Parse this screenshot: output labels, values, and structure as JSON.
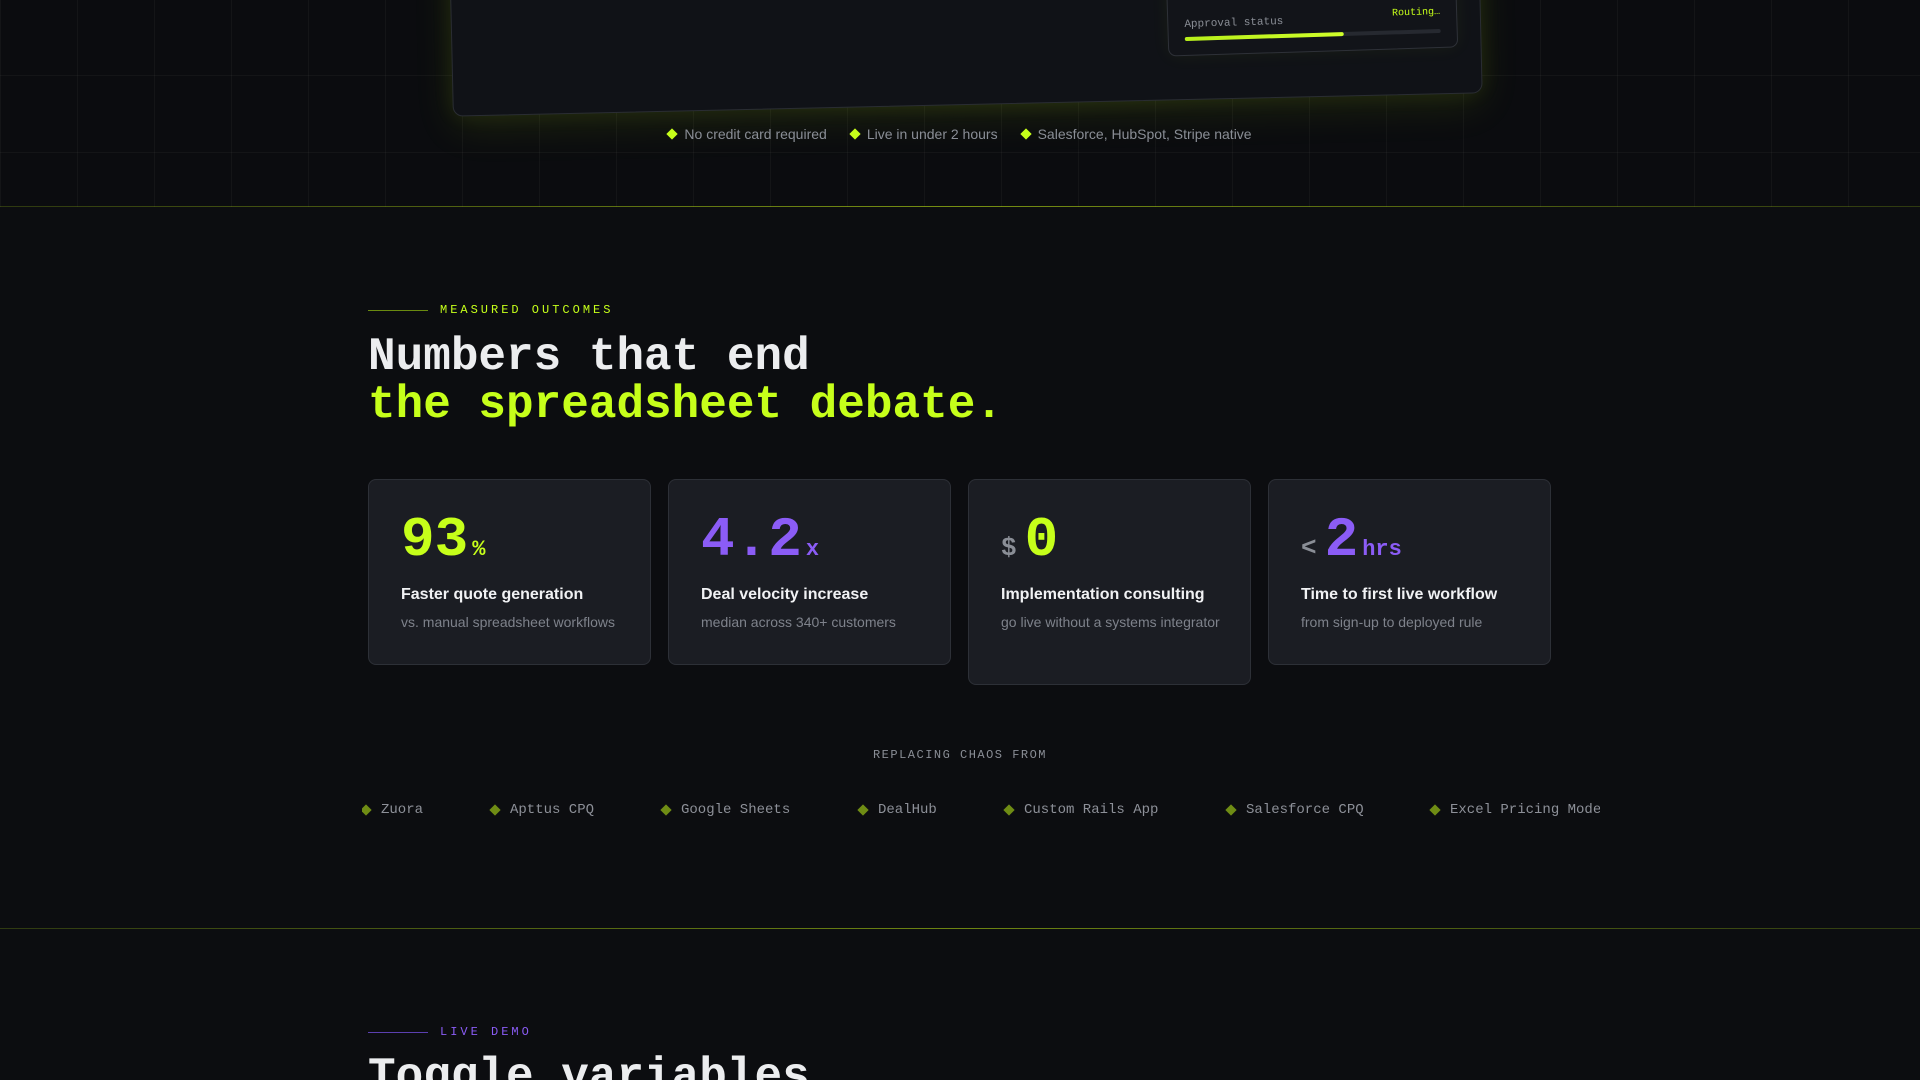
{
  "hero": {
    "approval": {
      "label": "Approval status",
      "status": "Routing…",
      "progress": 0.62
    },
    "features": [
      "No credit card required",
      "Live in under 2 hours",
      "Salesforce, HubSpot, Stripe native"
    ]
  },
  "outcomes": {
    "eyebrow": "MEASURED OUTCOMES",
    "headline_line1": "Numbers that end",
    "headline_line2": "the spreadsheet debate.",
    "stats": [
      {
        "prefix": "",
        "value": "93",
        "unit": "%",
        "label": "Faster quote generation",
        "desc": "vs. manual spreadsheet workflows",
        "accent": "#c6ff1a"
      },
      {
        "prefix": "",
        "value": "4.2",
        "unit": "x",
        "label": "Deal velocity increase",
        "desc": "median across 340+ customers",
        "accent": "#8b5cf6"
      },
      {
        "prefix": "$",
        "value": "0",
        "unit": "",
        "label": "Implementation consulting",
        "desc": "go live without a systems integrator",
        "accent": "#c6ff1a"
      },
      {
        "prefix": "<",
        "value": "2",
        "unit": "hrs",
        "label": "Time to first live workflow",
        "desc": "from sign-up to deployed rule",
        "accent": "#8b5cf6"
      }
    ],
    "replacing_label": "REPLACING CHAOS FROM",
    "replaced_tools": [
      "Zuora",
      "Apttus CPQ",
      "Google Sheets",
      "DealHub",
      "Custom Rails App",
      "Salesforce CPQ",
      "Excel Pricing Model"
    ]
  },
  "demo": {
    "eyebrow": "LIVE DEMO",
    "headline": "Toggle variables"
  },
  "colors": {
    "background": "#0c0d10",
    "lime_accent": "#c6ff1a",
    "purple_accent": "#8b5cf6",
    "card_bg": "#1b1d23"
  }
}
